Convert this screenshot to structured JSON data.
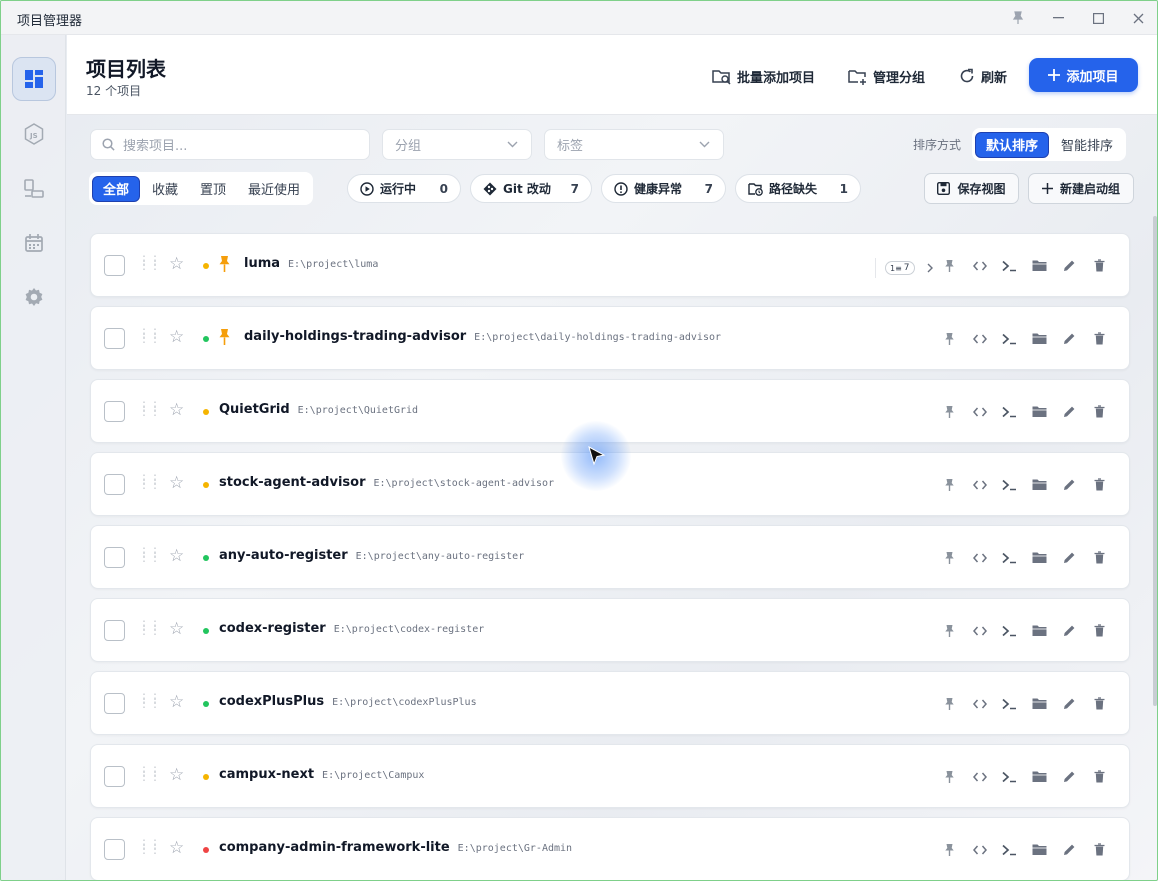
{
  "window": {
    "title": "项目管理器"
  },
  "header": {
    "title": "项目列表",
    "subtitle": "12 个项目",
    "batch_add": "批量添加项目",
    "manage_groups": "管理分组",
    "refresh": "刷新",
    "add_project": "添加项目"
  },
  "filters": {
    "search_placeholder": "搜索项目...",
    "group_placeholder": "分组",
    "tag_placeholder": "标签",
    "sort_label": "排序方式",
    "sort_default": "默认排序",
    "sort_smart": "智能排序",
    "tabs": [
      "全部",
      "收藏",
      "置顶",
      "最近使用"
    ],
    "active_tab": "全部",
    "chips": [
      {
        "label": "运行中",
        "count": "0"
      },
      {
        "label": "Git 改动",
        "count": "7"
      },
      {
        "label": "健康异常",
        "count": "7"
      },
      {
        "label": "路径缺失",
        "count": "1"
      }
    ],
    "save_view": "保存视图",
    "new_launch_group": "新建启动组"
  },
  "colors": {
    "accent": "#2563eb",
    "green": "#22c55e",
    "amber": "#f5b400",
    "red": "#ef4444",
    "pin": "#f59e0b"
  },
  "projects": [
    {
      "name": "luma",
      "path": "E:\\project\\luma",
      "status": "amber",
      "pinned": true,
      "badge": "7"
    },
    {
      "name": "daily-holdings-trading-advisor",
      "path": "E:\\project\\daily-holdings-trading-advisor",
      "status": "green",
      "pinned": true
    },
    {
      "name": "QuietGrid",
      "path": "E:\\project\\QuietGrid",
      "status": "amber",
      "pinned": false
    },
    {
      "name": "stock-agent-advisor",
      "path": "E:\\project\\stock-agent-advisor",
      "status": "amber",
      "pinned": false
    },
    {
      "name": "any-auto-register",
      "path": "E:\\project\\any-auto-register",
      "status": "green",
      "pinned": false
    },
    {
      "name": "codex-register",
      "path": "E:\\project\\codex-register",
      "status": "green",
      "pinned": false
    },
    {
      "name": "codexPlusPlus",
      "path": "E:\\project\\codexPlusPlus",
      "status": "green",
      "pinned": false
    },
    {
      "name": "campux-next",
      "path": "E:\\project\\Campux",
      "status": "amber",
      "pinned": false
    },
    {
      "name": "company-admin-framework-lite",
      "path": "E:\\project\\Gr-Admin",
      "status": "red",
      "pinned": false
    }
  ]
}
